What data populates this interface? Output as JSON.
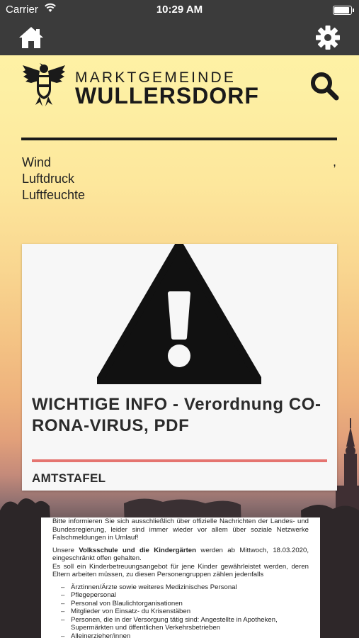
{
  "status_bar": {
    "carrier": "Carrier",
    "time": "10:29 AM",
    "battery_level": 0.95
  },
  "nav": {
    "home_icon": "home-icon",
    "settings_icon": "gear-icon"
  },
  "header": {
    "brand_line1": "MARKTGEMEINDE",
    "brand_line2": "WULLERSDORF",
    "logo_icon": "eagle-coat-of-arms-icon",
    "search_icon": "search-icon"
  },
  "weather": {
    "wind_label": "Wind",
    "pressure_label": "Luftdruck",
    "humidity_label": "Luftfeuchte",
    "separator": ","
  },
  "card": {
    "icon": "warning-triangle-icon",
    "title": "WICHTIGE INFO - Verordnung CO-RONA-VIRUS, PDF",
    "category": "AMTSTAFEL",
    "accent_color": "#e57470"
  },
  "document": {
    "para1": "Bitte informieren Sie sich ausschließlich über offizielle Nachrichten der Landes- und Bundesregierung, leider sind immer wieder vor allem über soziale Netzwerke Falschmeldungen in Umlauf!",
    "para2_prefix": "Unsere ",
    "para2_bold": "Volksschule und die Kindergärten",
    "para2_suffix": " werden ab Mittwoch, 18.03.2020, eingeschränkt offen gehalten.",
    "para3": "Es soll ein Kinderbetreuungsangebot für jene Kinder gewährleistet werden, deren Eltern arbeiten müssen, zu diesen Personengruppen zählen jedenfalls",
    "list": [
      "Ärztinnen/Ärzte sowie weiteres Medizinisches Personal",
      "Pflegepersonal",
      "Personal von Blaulichtorganisationen",
      "Mitglieder von Einsatz- du Krisenstäben",
      "Personen, die in der Versorgung tätig sind: Angestellte in Apotheken, Supermärkten und öffentlichen Verkehrsbetrieben",
      "Alleinerzieher/innen"
    ]
  }
}
